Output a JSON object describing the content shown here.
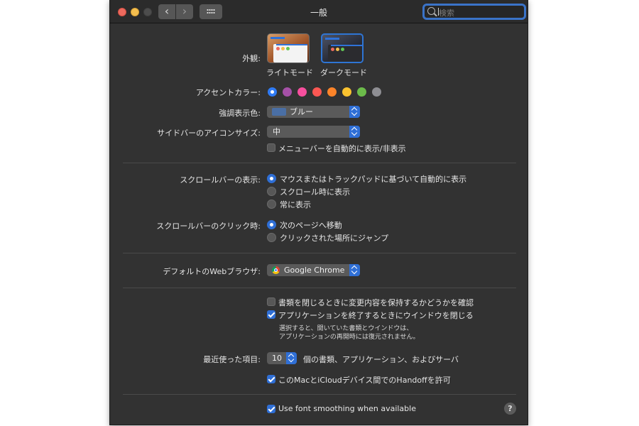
{
  "window": {
    "title": "一般",
    "search_placeholder": "検索",
    "nav": {
      "back": "‹",
      "forward": "›"
    }
  },
  "appearance": {
    "label": "外観:",
    "options": [
      {
        "label": "ライトモード",
        "selected": false
      },
      {
        "label": "ダークモード",
        "selected": true
      }
    ]
  },
  "accent": {
    "label": "アクセントカラー:",
    "colors": [
      "#2f7bf5",
      "#a550a7",
      "#f74f9e",
      "#fc5753",
      "#fd8429",
      "#fbc32f",
      "#6cbb4a",
      "#8e8e93"
    ],
    "selected_index": 0
  },
  "highlight": {
    "label": "強調表示色:",
    "value": "ブルー",
    "swatch": "#4a6fa5"
  },
  "sidebar_icon_size": {
    "label": "サイドバーのアイコンサイズ:",
    "value": "中"
  },
  "menubar_autohide": {
    "label": "メニューバーを自動的に表示/非表示",
    "checked": false
  },
  "scrollbar_show": {
    "label": "スクロールバーの表示:",
    "options": [
      {
        "label": "マウスまたはトラックパッドに基づいて自動的に表示",
        "selected": true
      },
      {
        "label": "スクロール時に表示",
        "selected": false
      },
      {
        "label": "常に表示",
        "selected": false
      }
    ]
  },
  "scrollbar_click": {
    "label": "スクロールバーのクリック時:",
    "options": [
      {
        "label": "次のページへ移動",
        "selected": true
      },
      {
        "label": "クリックされた場所にジャンプ",
        "selected": false
      }
    ]
  },
  "browser": {
    "label": "デフォルトのWebブラウザ:",
    "value": "Google Chrome"
  },
  "documents": {
    "ask_keep_changes": {
      "label": "書類を閉じるときに変更内容を保持するかどうかを確認",
      "checked": false
    },
    "close_windows": {
      "label": "アプリケーションを終了するときにウインドウを閉じる",
      "checked": true
    },
    "note_line1": "選択すると、開いていた書類とウインドウは、",
    "note_line2": "アプリケーションの再開時には復元されません。"
  },
  "recent_items": {
    "label": "最近使った項目:",
    "value": "10",
    "suffix": "個の書類、アプリケーション、およびサーバ"
  },
  "handoff": {
    "label": "このMacとiCloudデバイス間でのHandoffを許可",
    "checked": true
  },
  "font_smoothing": {
    "label": "Use font smoothing when available",
    "checked": true
  },
  "help": {
    "label": "?"
  }
}
